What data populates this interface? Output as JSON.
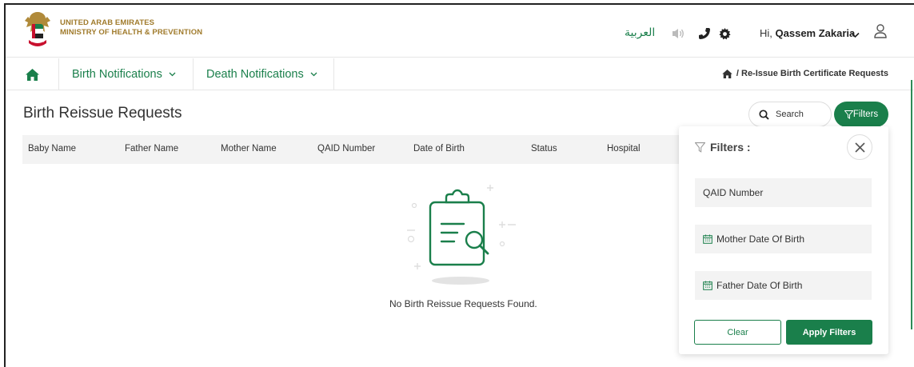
{
  "header": {
    "org_line1": "UNITED ARAB EMIRATES",
    "org_line2": "MINISTRY OF HEALTH & PREVENTION",
    "language_toggle": "العربية",
    "greeting_prefix": "Hi,",
    "user_name": "Qassem Zakaria"
  },
  "nav": {
    "items": [
      {
        "label": "Birth Notifications"
      },
      {
        "label": "Death Notifications"
      }
    ],
    "breadcrumb": "Re-Issue Birth Certificate Requests"
  },
  "page": {
    "title": "Birth Reissue Requests",
    "search_placeholder": "Search",
    "filters_button": "Filters"
  },
  "table": {
    "columns": [
      "Baby Name",
      "Father Name",
      "Mother Name",
      "QAID Number",
      "Date of Birth",
      "Status",
      "Hospital"
    ],
    "empty_message": "No Birth Reissue Requests Found."
  },
  "filter_panel": {
    "title": "Filters :",
    "fields": [
      {
        "placeholder": "QAID Number"
      },
      {
        "placeholder": "Mother Date Of Birth"
      },
      {
        "placeholder": "Father Date Of Birth"
      }
    ],
    "clear_label": "Clear",
    "apply_label": "Apply Filters"
  },
  "colors": {
    "brand_green": "#1a7f4b",
    "gold": "#a07b2c",
    "table_header_bg": "#f3f3f3"
  }
}
